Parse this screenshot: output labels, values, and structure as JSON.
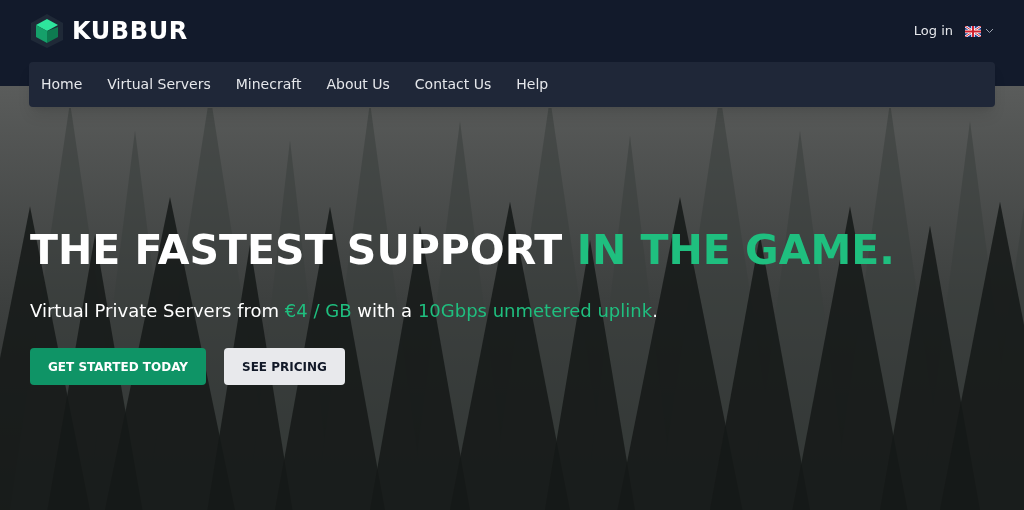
{
  "header": {
    "brand": "KUBBUR",
    "login": "Log in"
  },
  "nav": {
    "items": [
      "Home",
      "Virtual Servers",
      "Minecraft",
      "About Us",
      "Contact Us",
      "Help"
    ]
  },
  "hero": {
    "headline": [
      {
        "text": "THE FASTEST SUPPORT ",
        "highlight": false
      },
      {
        "text": "IN THE GAME.",
        "highlight": true
      }
    ],
    "subtitle": [
      {
        "text": "Virtual Private Servers from ",
        "highlight": false
      },
      {
        "text": "€4 / GB",
        "highlight": true
      },
      {
        "text": " with a ",
        "highlight": false
      },
      {
        "text": "10Gbps unmetered uplink",
        "highlight": true
      },
      {
        "text": ".",
        "highlight": false
      }
    ],
    "buttons": [
      {
        "label": "GET STARTED TODAY",
        "kind": "primary"
      },
      {
        "label": "SEE PRICING",
        "kind": "secondary"
      }
    ]
  }
}
